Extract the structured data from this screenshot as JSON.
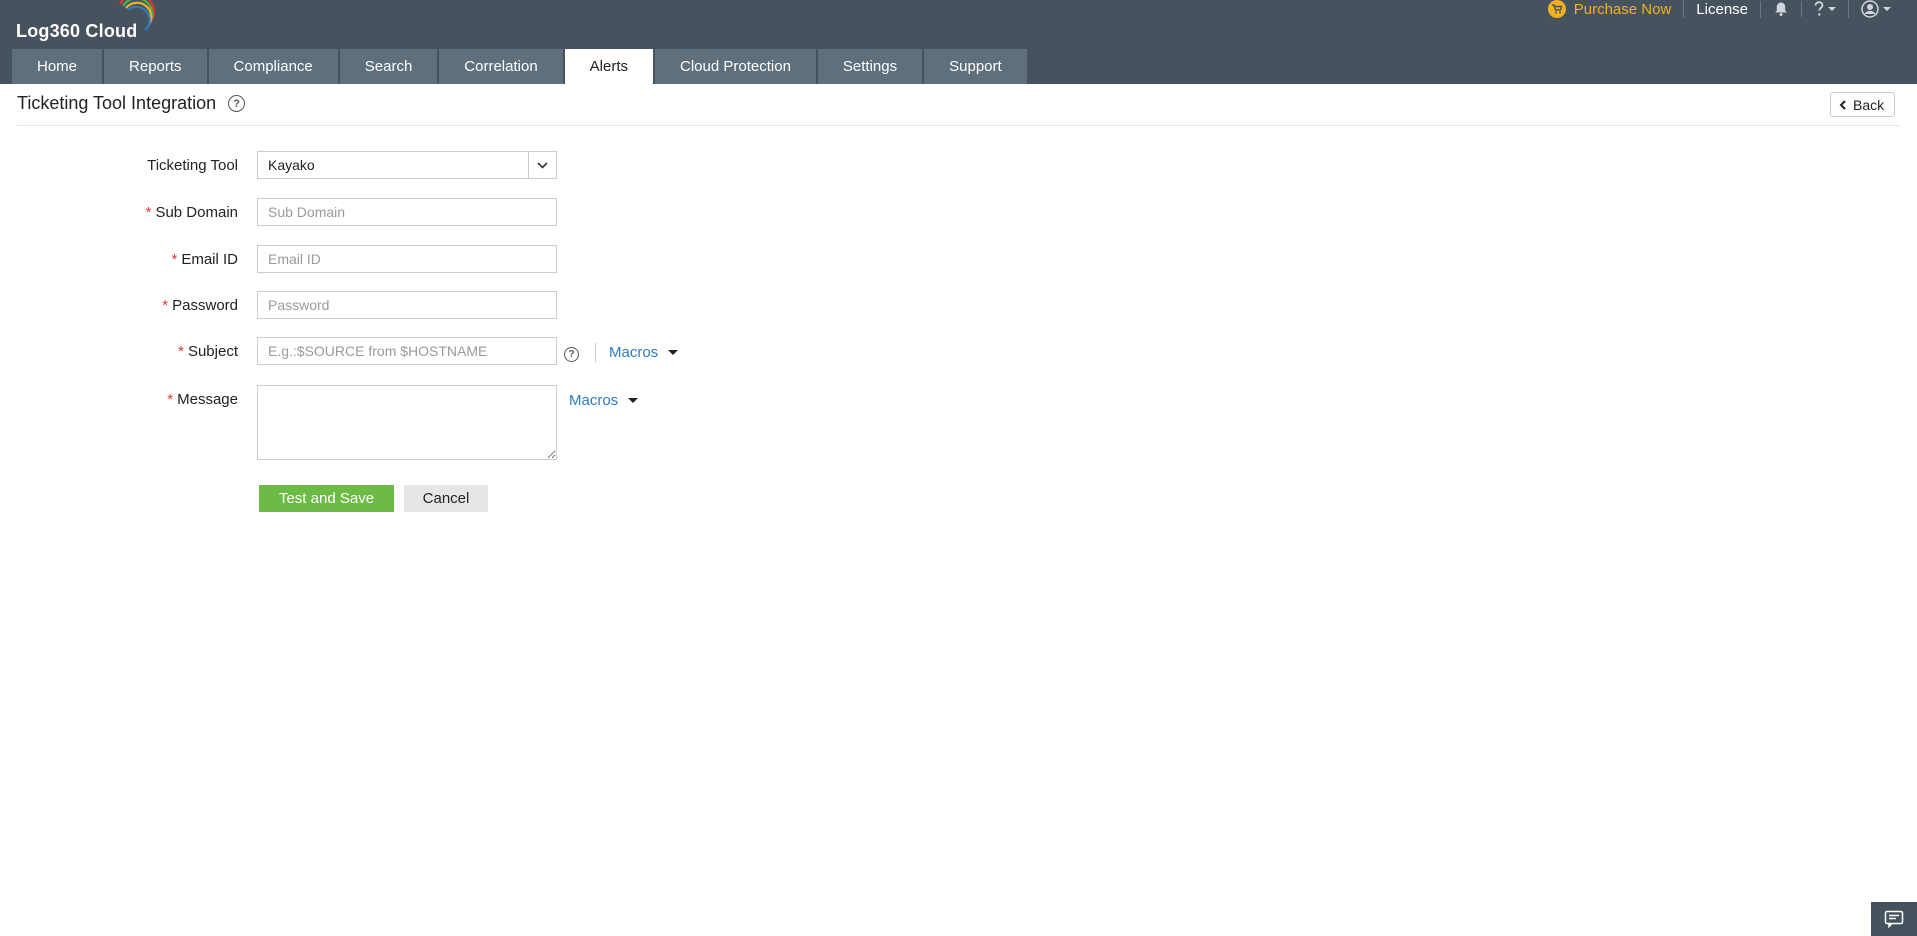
{
  "app": {
    "logo_text": "Log360 Cloud"
  },
  "header": {
    "purchase_label": "Purchase Now",
    "license_label": "License",
    "icons": [
      "cart-icon",
      "bell-icon",
      "help-icon",
      "user-icon"
    ],
    "accent_color": "#f2b01e"
  },
  "tabs": [
    {
      "label": "Home",
      "active": false
    },
    {
      "label": "Reports",
      "active": false
    },
    {
      "label": "Compliance",
      "active": false
    },
    {
      "label": "Search",
      "active": false
    },
    {
      "label": "Correlation",
      "active": false
    },
    {
      "label": "Alerts",
      "active": true
    },
    {
      "label": "Cloud Protection",
      "active": false
    },
    {
      "label": "Settings",
      "active": false
    },
    {
      "label": "Support",
      "active": false
    }
  ],
  "page": {
    "title": "Ticketing Tool Integration",
    "back_label": "Back"
  },
  "form": {
    "ticketing_tool": {
      "label": "Ticketing Tool",
      "value": "Kayako"
    },
    "sub_domain": {
      "label": "Sub Domain",
      "placeholder": "Sub Domain",
      "value": ""
    },
    "email_id": {
      "label": "Email ID",
      "placeholder": "Email ID",
      "value": ""
    },
    "password": {
      "label": "Password",
      "placeholder": "Password",
      "value": ""
    },
    "subject": {
      "label": "Subject",
      "placeholder": "E.g.:$SOURCE from $HOSTNAME",
      "value": "",
      "macros_label": "Macros"
    },
    "message": {
      "label": "Message",
      "value": "",
      "macros_label": "Macros"
    },
    "required_marker": "*",
    "save_label": "Test and Save",
    "cancel_label": "Cancel"
  },
  "colors": {
    "topbar": "#46535f",
    "tab": "#5f6f7c",
    "save_button": "#6bbb45",
    "link": "#2c7cc4",
    "required": "#e03a3a"
  }
}
